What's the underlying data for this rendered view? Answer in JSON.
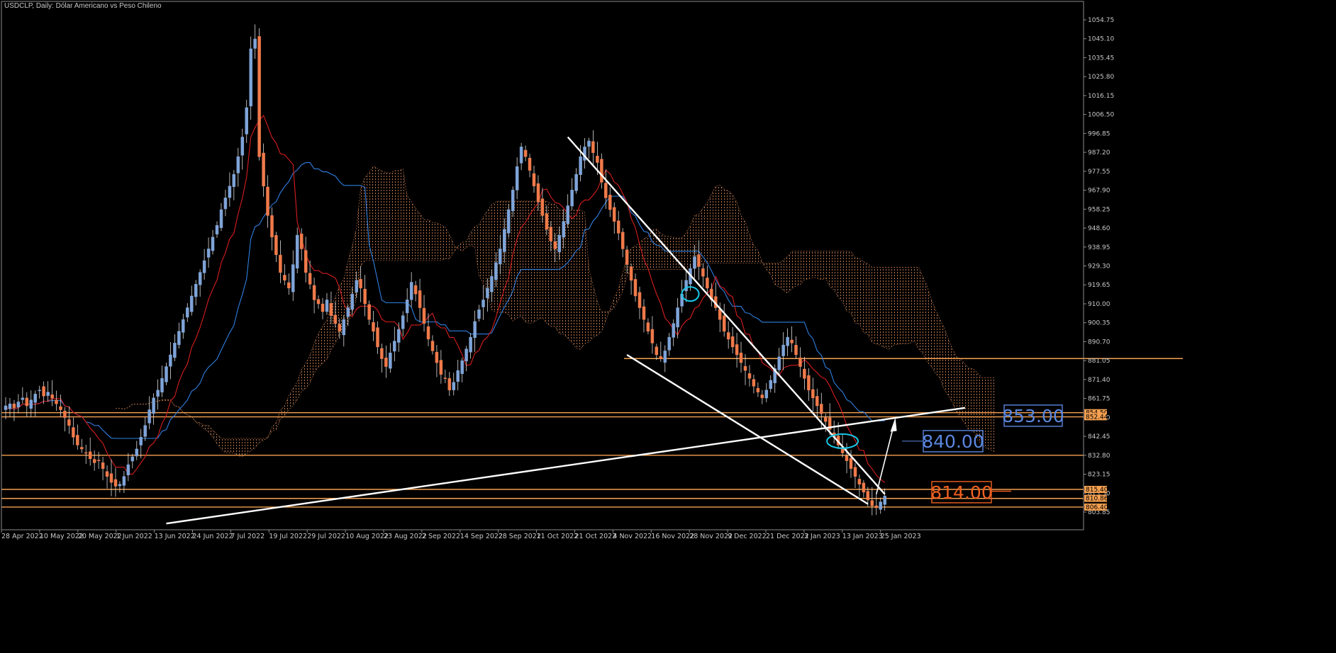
{
  "window": {
    "title": "USDCLP, Daily:  Dólar Americano vs Peso Chileno"
  },
  "colors": {
    "background": "#000000",
    "grid": "#1a1a1a",
    "axis": "#8c8c8c",
    "bull": "#7fa4d8",
    "bear": "#f07a4a",
    "tenkan": "#d81e1e",
    "kijun": "#2f7fe0",
    "cloud": "#d98a5a",
    "level": "#f5a050",
    "trend": "#ffffff",
    "circle": "#18c8e8",
    "label_blue": "#5b87e0",
    "label_orange": "#f06020"
  },
  "chart_data": {
    "type": "candlestick",
    "symbol": "USDCLP",
    "timeframe": "Daily",
    "title": "USDCLP, Daily:  Dólar Americano vs Peso Chileno",
    "ylim": [
      803.65,
      1062.0
    ],
    "y_ticks": [
      "1054.75",
      "1045.10",
      "1035.45",
      "1025.80",
      "1016.15",
      "1006.50",
      "996.85",
      "987.20",
      "977.55",
      "967.90",
      "958.25",
      "948.60",
      "938.95",
      "929.30",
      "919.65",
      "910.00",
      "900.35",
      "890.70",
      "881.05",
      "871.40",
      "861.75",
      "852.10",
      "842.45",
      "832.80",
      "823.15",
      "813.50",
      "803.85"
    ],
    "x_ticks": [
      "28 Apr 2022",
      "10 May 2022",
      "20 May 2022",
      "1 Jun 2022",
      "13 Jun 2022",
      "24 Jun 2022",
      "7 Jul 2022",
      "19 Jul 2022",
      "29 Jul 2022",
      "10 Aug 2022",
      "23 Aug 2022",
      "2 Sep 2022",
      "14 Sep 2022",
      "28 Sep 2022",
      "11 Oct 2022",
      "21 Oct 2022",
      "4 Nov 2022",
      "16 Nov 2022",
      "28 Nov 2022",
      "9 Dec 2022",
      "21 Dec 2022",
      "3 Jan 2023",
      "13 Jan 2023",
      "25 Jan 2023"
    ],
    "closes": [
      858,
      859,
      857,
      860,
      862,
      858,
      861,
      864,
      866,
      863,
      865,
      862,
      859,
      856,
      852,
      848,
      842,
      838,
      836,
      834,
      831,
      829,
      830,
      826,
      822,
      819,
      817,
      818,
      822,
      828,
      832,
      836,
      842,
      848,
      856,
      862,
      866,
      872,
      878,
      884,
      890,
      896,
      902,
      908,
      914,
      920,
      926,
      932,
      938,
      944,
      950,
      958,
      964,
      970,
      976,
      985,
      995,
      1010,
      1040,
      1045,
      985,
      970,
      955,
      944,
      935,
      926,
      922,
      918,
      930,
      945,
      938,
      926,
      920,
      912,
      910,
      906,
      912,
      904,
      900,
      896,
      902,
      908,
      915,
      922,
      918,
      910,
      902,
      896,
      888,
      882,
      878,
      885,
      891,
      897,
      904,
      912,
      921,
      915,
      908,
      900,
      892,
      886,
      880,
      874,
      872,
      866,
      870,
      876,
      881,
      887,
      893,
      901,
      907,
      912,
      918,
      924,
      931,
      938,
      948,
      958,
      968,
      980,
      990,
      985,
      978,
      970,
      962,
      955,
      948,
      942,
      938,
      945,
      952,
      960,
      968,
      976,
      985,
      990,
      993,
      987,
      982,
      972,
      964,
      958,
      952,
      946,
      938,
      930,
      922,
      914,
      908,
      902,
      896,
      890,
      884,
      882,
      886,
      893,
      900,
      908,
      915,
      922,
      928,
      934,
      929,
      924,
      918,
      912,
      908,
      902,
      896,
      892,
      888,
      884,
      880,
      876,
      872,
      868,
      865,
      862,
      866,
      871,
      877,
      883,
      889,
      893,
      890,
      884,
      878,
      872,
      866,
      862,
      858,
      854,
      850,
      846,
      842,
      838,
      834,
      830,
      826,
      822,
      818,
      814,
      810,
      807,
      806,
      809,
      812
    ],
    "price_tags": [
      {
        "value": 854.5,
        "label": "854.50",
        "color": "#f5a050",
        "text_color": "#000000"
      },
      {
        "value": 852.44,
        "label": "852.44",
        "color": "#f5a050",
        "text_color": "#000000"
      },
      {
        "value": 815.4,
        "label": "815.40",
        "color": "#f5a050",
        "text_color": "#000000"
      },
      {
        "value": 810.86,
        "label": "810.86",
        "color": "#f5a050",
        "text_color": "#000000"
      },
      {
        "value": 806.4,
        "label": "806.40",
        "color": "#f5a050",
        "text_color": "#000000"
      }
    ],
    "annotations": [
      {
        "text": "853.00",
        "value": 853.0,
        "color": "#5b87e0"
      },
      {
        "text": "840.00",
        "value": 840.0,
        "color": "#5b87e0"
      },
      {
        "text": "814.00",
        "value": 814.0,
        "color": "#f06020"
      }
    ],
    "horizontal_levels": [
      854.5,
      852.4,
      832.8,
      815.4,
      810.8,
      806.4,
      882.1
    ]
  }
}
